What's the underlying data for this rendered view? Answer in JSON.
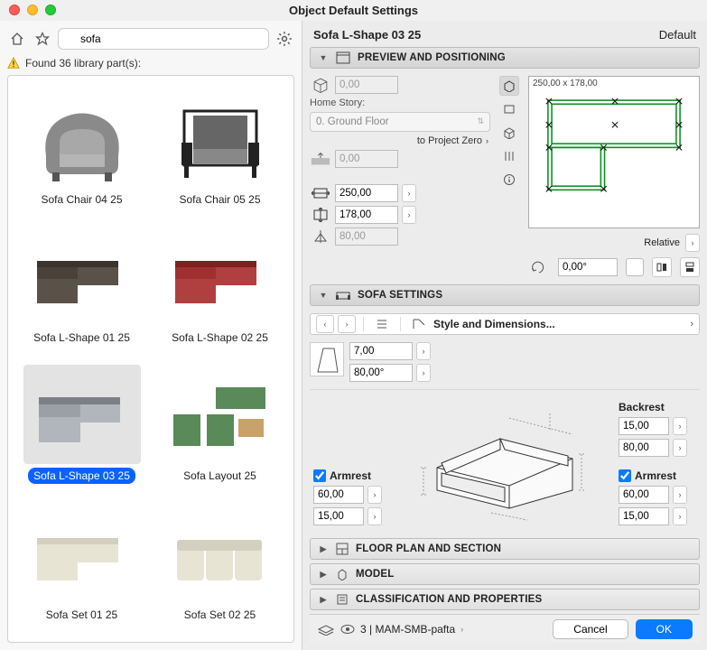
{
  "title": "Object Default Settings",
  "search": {
    "value": "sofa"
  },
  "status": {
    "text": "Found 36 library part(s):"
  },
  "items": [
    {
      "label": "Sofa Chair 04 25"
    },
    {
      "label": "Sofa Chair 05 25"
    },
    {
      "label": "Sofa L-Shape 01 25"
    },
    {
      "label": "Sofa L-Shape 02 25"
    },
    {
      "label": "Sofa L-Shape 03 25"
    },
    {
      "label": "Sofa Layout 25"
    },
    {
      "label": "Sofa Set 01 25"
    },
    {
      "label": "Sofa Set 02 25"
    }
  ],
  "header": {
    "name": "Sofa L-Shape 03 25",
    "default": "Default"
  },
  "sections": {
    "preview": "PREVIEW AND POSITIONING",
    "sofa": "SOFA SETTINGS",
    "floor": "FLOOR PLAN AND SECTION",
    "model": "MODEL",
    "class": "CLASSIFICATION AND PROPERTIES"
  },
  "preview": {
    "elev": "0,00",
    "home_story_label": "Home Story:",
    "home_story": "0. Ground Floor",
    "to_project_zero": "to Project Zero",
    "elev2": "0,00",
    "width": "250,00",
    "depth": "178,00",
    "height": "80,00",
    "dims_label": "250,00 x 178,00",
    "relative_label": "Relative",
    "angle": "0,00°"
  },
  "sofa": {
    "style": "Style and Dimensions...",
    "p1": "7,00",
    "p2": "80,00°",
    "backrest_label": "Backrest",
    "backrest1": "15,00",
    "backrest2": "80,00",
    "arm_left_label": "Armrest",
    "arm_left1": "60,00",
    "arm_left2": "15,00",
    "arm_right_label": "Armrest",
    "arm_right1": "60,00",
    "arm_right2": "15,00"
  },
  "footer": {
    "layer": "3 | MAM-SMB-pafta",
    "cancel": "Cancel",
    "ok": "OK"
  }
}
